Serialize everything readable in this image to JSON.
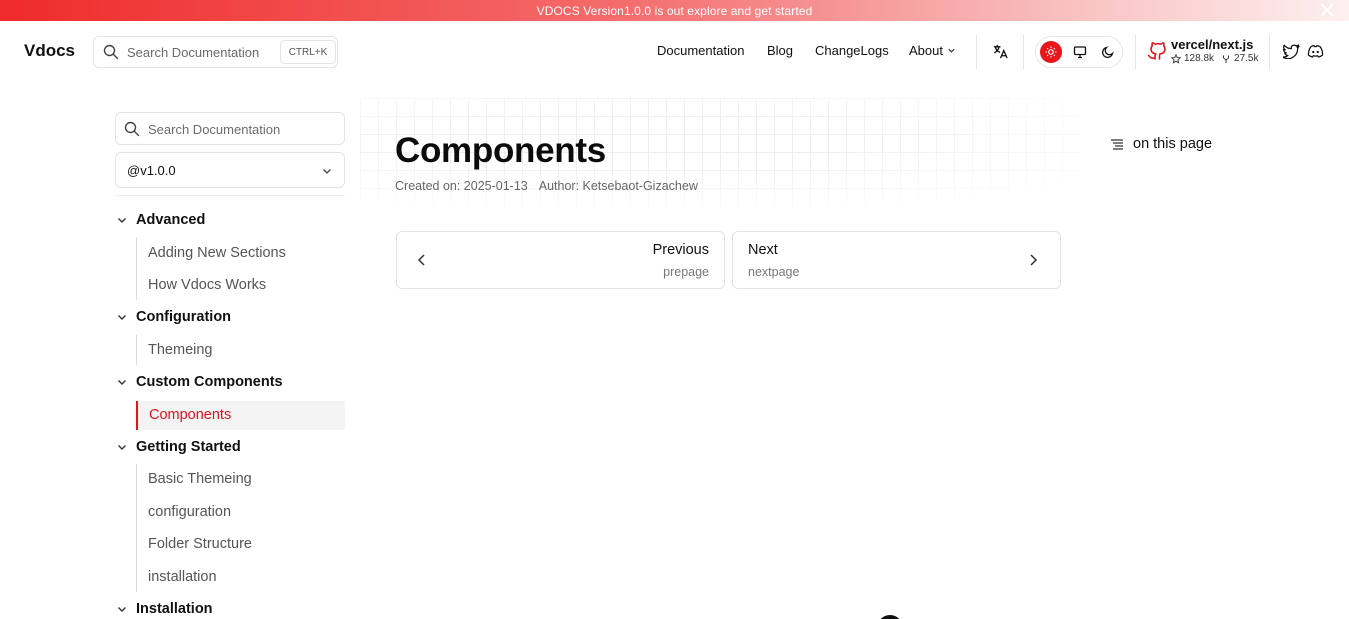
{
  "banner": {
    "text": "VDOCS Version1.0.0 is out explore and get started"
  },
  "header": {
    "brand": "Vdocs",
    "search": {
      "placeholder": "Search Documentation",
      "shortcut": "CTRL+K"
    },
    "nav": [
      "Documentation",
      "Blog",
      "ChangeLogs",
      "About"
    ],
    "repo": {
      "name": "vercel/next.js",
      "stars": "128.8k",
      "forks": "27.5k"
    }
  },
  "sidebar": {
    "search_placeholder": "Search Documentation",
    "version": "@v1.0.0",
    "sections": [
      {
        "title": "Advanced",
        "items": [
          "Adding New Sections",
          "How Vdocs Works"
        ]
      },
      {
        "title": "Configuration",
        "items": [
          "Themeing"
        ]
      },
      {
        "title": "Custom Components",
        "items": [
          "Components"
        ]
      },
      {
        "title": "Getting Started",
        "items": [
          "Basic Themeing",
          "configuration",
          "Folder Structure",
          "installation"
        ]
      },
      {
        "title": "Installation",
        "items": []
      }
    ],
    "active_item": "Components"
  },
  "page": {
    "title": "Components",
    "created": "Created on: 2025-01-13",
    "author": "Author: Ketsebaot-Gizachew"
  },
  "pager": {
    "prev": {
      "label": "Previous",
      "sub": "prepage"
    },
    "next": {
      "label": "Next",
      "sub": "nextpage"
    }
  },
  "toc": {
    "label": "on this page"
  },
  "colors": {
    "accent": "#e0141a",
    "banner_start": "#ef2b2b"
  }
}
